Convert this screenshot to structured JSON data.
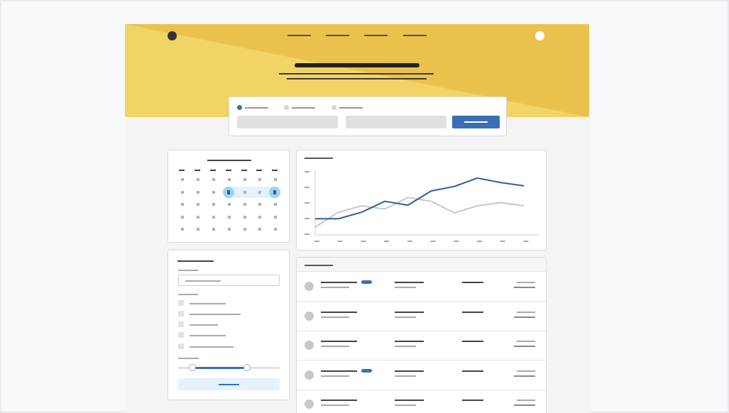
{
  "app": {
    "title": ""
  },
  "header": {
    "nav": [
      "",
      "",
      "",
      ""
    ],
    "title": "",
    "subtitle": ""
  },
  "search": {
    "trip_types": [
      "",
      "",
      ""
    ],
    "selected_trip_type": 0,
    "fields": [
      "",
      ""
    ],
    "submit_label": ""
  },
  "calendar": {
    "month_label": "",
    "weekdays": [
      "",
      "",
      "",
      "",
      "",
      "",
      ""
    ],
    "selected_days": [
      4,
      7
    ]
  },
  "filters": {
    "title": "",
    "input_label": "",
    "input_value": "",
    "options_label": "",
    "options": [
      "",
      "",
      "",
      "",
      ""
    ],
    "range_label": "",
    "range": [
      0.14,
      0.68
    ],
    "apply_label": ""
  },
  "chart_data": {
    "type": "line",
    "title": "",
    "x": [
      1,
      2,
      3,
      4,
      5,
      6,
      7,
      8,
      9,
      10,
      11,
      12,
      13,
      14,
      15
    ],
    "ylim": [
      0,
      100
    ],
    "grid": false,
    "series": [
      {
        "color": "#2f5e9e",
        "values": [
          25,
          25,
          35,
          52,
          46,
          68,
          75,
          88,
          81,
          76
        ]
      },
      {
        "color": "#c8c8c8",
        "values": [
          12,
          35,
          45,
          40,
          58,
          52,
          34,
          45,
          50,
          45
        ]
      }
    ]
  },
  "results": {
    "title": "",
    "columns": [
      "",
      "",
      "",
      ""
    ],
    "rows": [
      {
        "name": "",
        "badge": true
      },
      {
        "name": "",
        "badge": false
      },
      {
        "name": "",
        "badge": false
      },
      {
        "name": "",
        "badge": true
      },
      {
        "name": "",
        "badge": false
      }
    ]
  },
  "colors": {
    "hero": "#ebc14e",
    "hero_light": "#f2d466",
    "accent": "#3a6fb5",
    "selection": "#9fd3f3"
  }
}
